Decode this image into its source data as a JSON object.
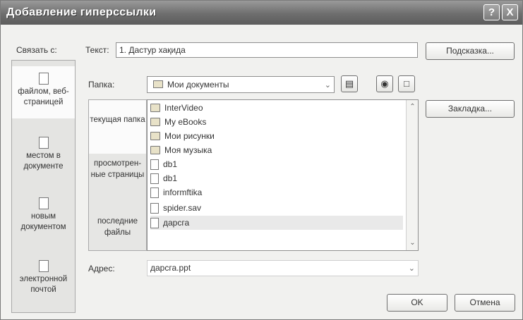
{
  "title": "Добавление гиперссылки",
  "title_buttons": {
    "help": "?",
    "close": "X"
  },
  "link_to_label": "Связать с:",
  "text_label": "Текст:",
  "text_value": "1. Дастур хақида",
  "hint_button": "Подсказка...",
  "folder_label": "Папка:",
  "folder_value": "Мои документы",
  "bookmark_button": "Закладка...",
  "address_label": "Адрес:",
  "address_value": "дарсга.ppt",
  "ok_button": "OK",
  "cancel_button": "Отмена",
  "places": [
    {
      "label": "файлом, веб-страницей",
      "icon": "web-file-icon"
    },
    {
      "label": "местом в документе",
      "icon": "place-in-document-icon"
    },
    {
      "label": "новым документом",
      "icon": "new-document-icon"
    },
    {
      "label": "электронной почтой",
      "icon": "email-icon"
    }
  ],
  "subplaces": [
    {
      "label": "текущая папка"
    },
    {
      "label": "просмотрен-ные страницы"
    },
    {
      "label": "последние файлы"
    }
  ],
  "files": [
    {
      "name": "InterVideo",
      "icon": "folder-icon"
    },
    {
      "name": "My eBooks",
      "icon": "folder-icon"
    },
    {
      "name": "Мои рисунки",
      "icon": "folder-icon"
    },
    {
      "name": "Моя музыка",
      "icon": "folder-icon"
    },
    {
      "name": "db1",
      "icon": "database-icon"
    },
    {
      "name": "db1",
      "icon": "database-icon"
    },
    {
      "name": "informftika",
      "icon": "word-document-icon"
    },
    {
      "name": "spider.sav",
      "icon": "file-icon"
    },
    {
      "name": "дарсга",
      "icon": "presentation-icon"
    }
  ],
  "colors": {
    "titlebar": "#6e6e6e",
    "window_bg": "#f1f1ef",
    "selection": "#e9e9e9"
  }
}
